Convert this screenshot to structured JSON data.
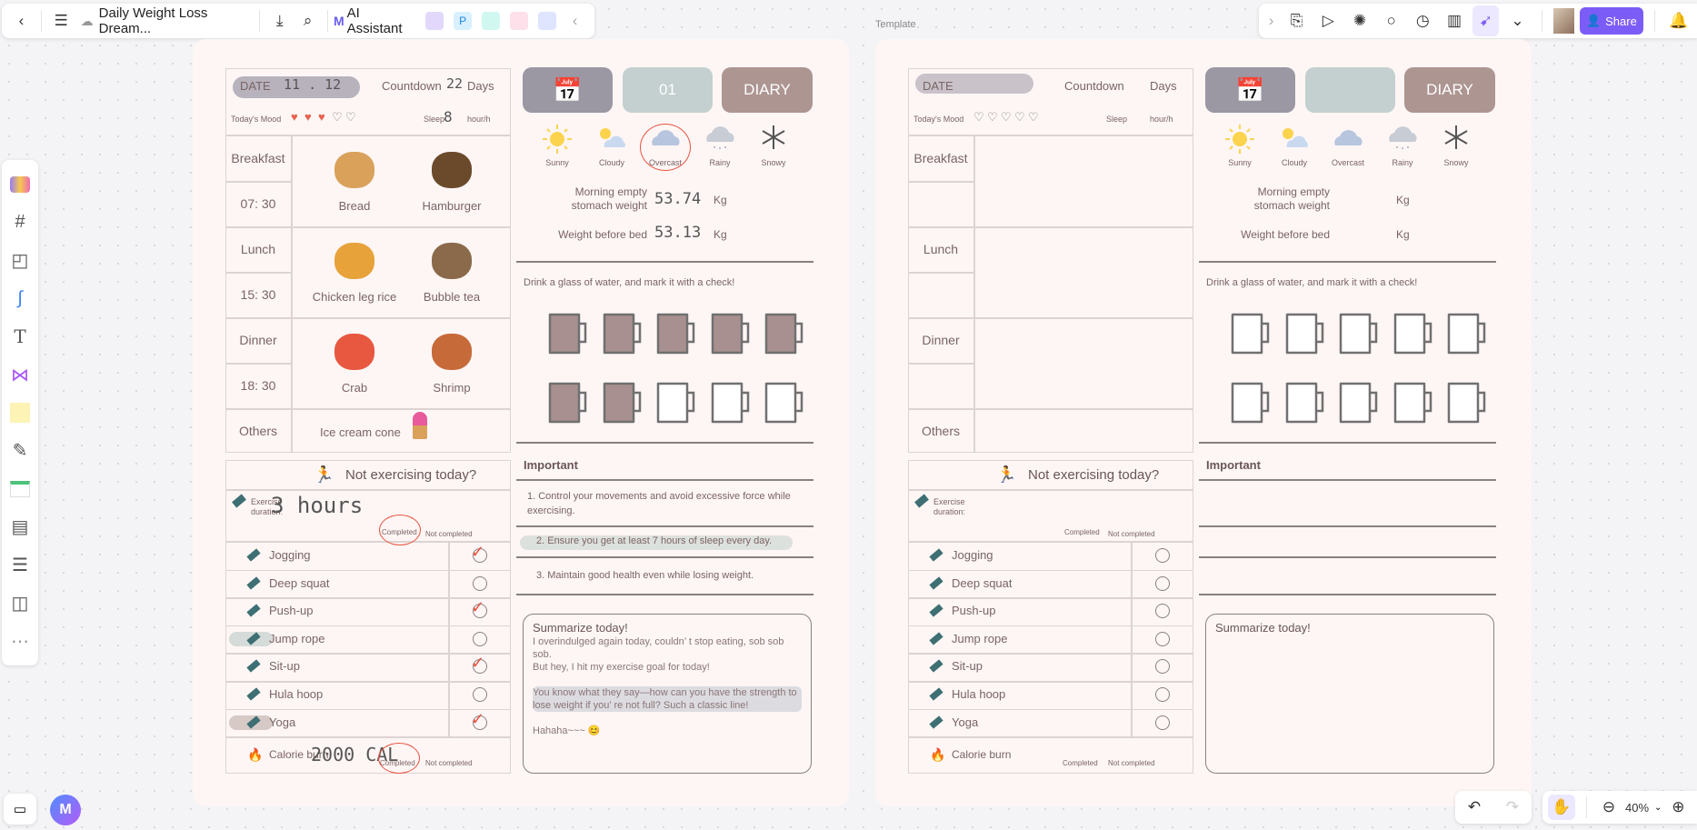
{
  "toolbar": {
    "doc_title": "Daily Weight Loss Dream...",
    "ai_label": "AI Assistant",
    "share_label": "Share",
    "template_label": "Template",
    "zoom_level": "40%",
    "accent": "#7c5cf6"
  },
  "labels": {
    "date": "DATE",
    "countdown": "Countdown",
    "days": "Days",
    "mood": "Today's Mood",
    "sleep": "Sleep",
    "sleep_unit": "hour/h",
    "diary": "DIARY",
    "weather": [
      "Sunny",
      "Cloudy",
      "Overcast",
      "Rainy",
      "Snowy"
    ],
    "morning_weight": [
      "Morning empty",
      "stomach weight"
    ],
    "bed_weight": "Weight before bed",
    "kg": "Kg",
    "water_prompt": "Drink a glass of water, and mark it with a check!",
    "important": "Important",
    "not_exercising": "Not exercising today?",
    "exercise_duration": [
      "Exercise",
      "duration:"
    ],
    "completed": "Completed",
    "not_completed": "Not completed",
    "calorie": "Calorie burn",
    "summary_title": "Summarize today!",
    "meals": [
      "Breakfast",
      "Lunch",
      "Dinner"
    ],
    "others": "Others",
    "exercises": [
      "Jogging",
      "Deep squat",
      "Push-up",
      "Jump rope",
      "Sit-up",
      "Hula hoop",
      "Yoga"
    ]
  },
  "pages": [
    {
      "date": "11 . 12",
      "countdown": "22",
      "mood_filled": 3,
      "mood_total": 5,
      "sleep": "8",
      "day_number": "01",
      "weather_selected": "Overcast",
      "morning_weight": "53.74",
      "bed_weight": "53.13",
      "water_filled": 7,
      "water_total": 10,
      "meal_times": [
        "07: 30",
        "15: 30",
        "18: 30"
      ],
      "foods": [
        [
          "Bread",
          "Hamburger"
        ],
        [
          "Chicken leg rice",
          "Bubble tea"
        ],
        [
          "Crab",
          "Shrimp"
        ]
      ],
      "others_food": "Ice cream cone",
      "exercise_duration": "3 hours",
      "exercise_status": "Completed",
      "exercise_checked": [
        true,
        false,
        true,
        false,
        true,
        false,
        true
      ],
      "exercise_highlight": [
        false,
        false,
        false,
        true,
        false,
        false,
        true
      ],
      "calorie": "2000 CAL",
      "calorie_status": "Completed",
      "important_items": [
        "1. Control your movements and avoid excessive force while exercising.",
        "2. Ensure you get at least 7 hours of sleep every day.",
        "3. Maintain good health even while losing weight."
      ],
      "summary": [
        "I overindulged again today, couldn’ t stop eating, sob sob sob.",
        "But hey, I hit my exercise goal for today!",
        "",
        "You know what they say—how can you have the strength to lose weight if you’ re not full? Such a classic line!",
        "",
        "Hahaha~~~ 😊"
      ]
    },
    {
      "date": "",
      "countdown": "",
      "mood_filled": 0,
      "mood_total": 5,
      "sleep": "",
      "day_number": "",
      "weather_selected": "",
      "morning_weight": "",
      "bed_weight": "",
      "water_filled": 0,
      "water_total": 10,
      "meal_times": [
        "",
        "",
        ""
      ],
      "foods": [],
      "others_food": "",
      "exercise_duration": "",
      "exercise_status": "",
      "exercise_checked": [
        false,
        false,
        false,
        false,
        false,
        false,
        false
      ],
      "exercise_highlight": [
        false,
        false,
        false,
        false,
        false,
        false,
        false
      ],
      "calorie": "",
      "calorie_status": "",
      "important_items": [],
      "summary": []
    }
  ],
  "colors": {
    "card_bg": "#fdf6f5",
    "text": "#7a6464",
    "calendar_btn": "#9b97a3",
    "day_btn": "#c3d0cf",
    "diary_btn": "#ad9592",
    "mug_fill": "#a89090",
    "check_red": "#e8533f"
  }
}
